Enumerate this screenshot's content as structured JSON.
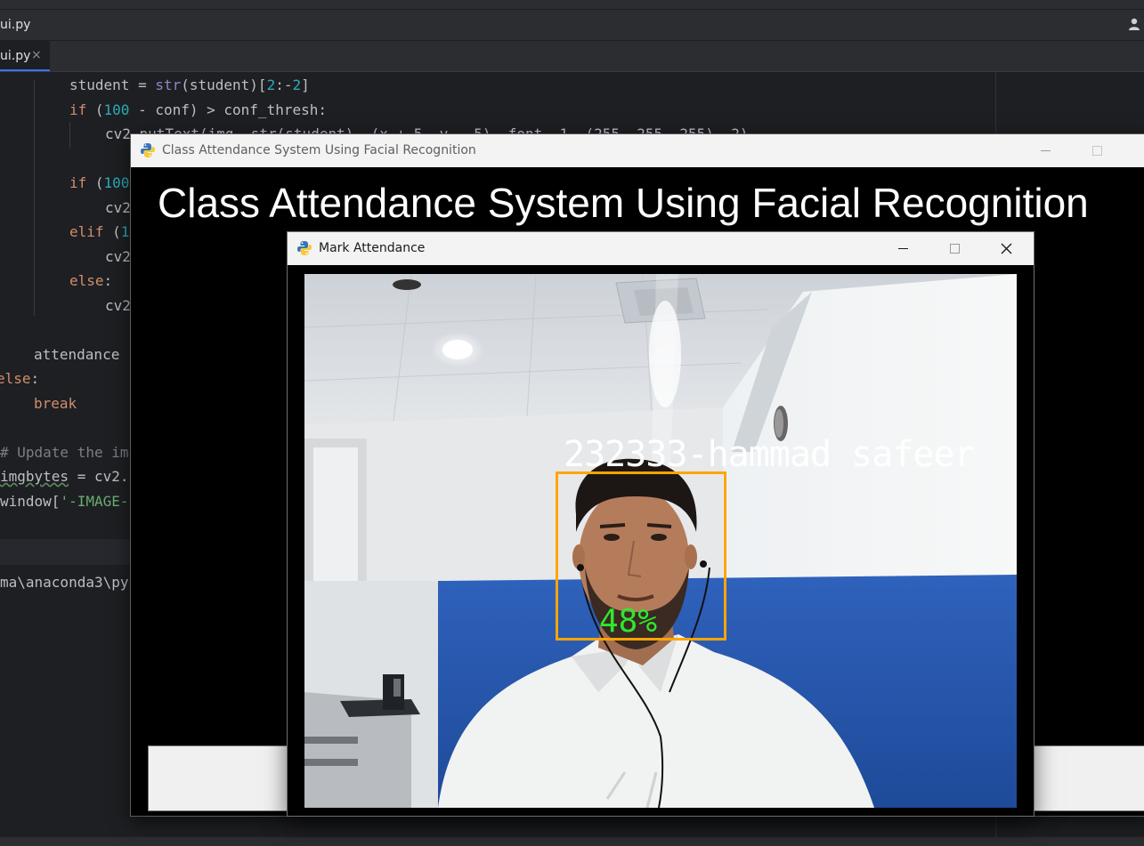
{
  "ide": {
    "breadcrumb_file": "ui.py",
    "tab_label": "ui.py",
    "tab_close": "×",
    "code": {
      "l1": {
        "a": "student = ",
        "b": "str",
        "c": "(student)[",
        "d": "2",
        "e": ":-",
        "f": "2",
        "g": "]"
      },
      "l2": {
        "a": "if",
        "b": " (",
        "c": "100",
        "d": " - conf) > conf_thresh:"
      },
      "l3": {
        "a": "cv2.putText(img, str(student), (x + 5, y - 5), font, 1, (255, 255, 255), 2)"
      },
      "l4": {
        "a": "if",
        "b": " (",
        "c": "100"
      },
      "l5": {
        "a": "cv2"
      },
      "l6": {
        "a": "elif",
        "b": " (",
        "c": "1"
      },
      "l7": {
        "a": "cv2"
      },
      "l8": {
        "a": "else",
        "b": ":"
      },
      "l9": {
        "a": "cv2"
      },
      "l10": {
        "a": "attendance"
      },
      "l11": {
        "a": "else",
        "b": ":"
      },
      "l12": {
        "a": "break"
      },
      "l13": {
        "a": "# Update the im"
      },
      "l14": {
        "a": "imgbytes",
        "b": " = cv2."
      },
      "l15": {
        "a": "window[",
        "b": "'-IMAGE-"
      },
      "l16": {
        "a": "ma\\anaconda3\\py"
      }
    }
  },
  "main_window": {
    "title": "Class Attendance System Using Facial Recognition",
    "heading": "Class Attendance System Using Facial Recognition"
  },
  "attendance_window": {
    "title": "Mark Attendance",
    "detected_label": "232333-hammad safeer",
    "confidence": "48%"
  },
  "colors": {
    "face_box": "#ffa500",
    "confidence_text": "#2ee82e",
    "wall_blue": "#2a5cb8"
  },
  "icons": [
    "python-icon",
    "minimize-icon",
    "maximize-icon",
    "close-icon",
    "user-icon"
  ]
}
